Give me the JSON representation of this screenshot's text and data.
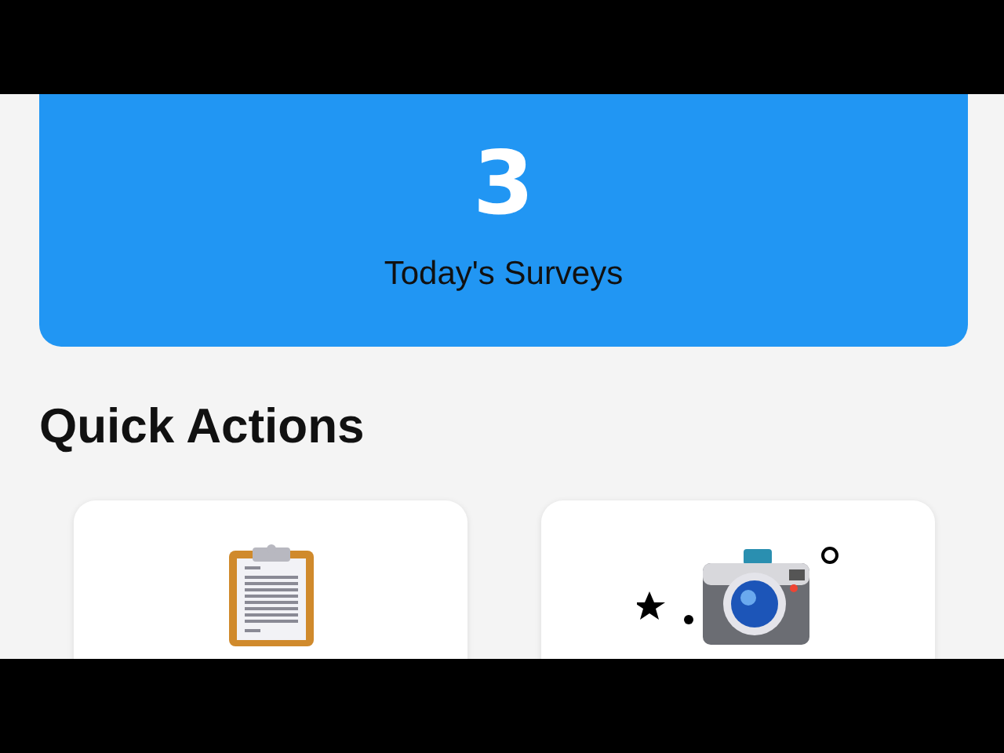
{
  "stat_card": {
    "value": "3",
    "label": "Today's Surveys"
  },
  "section": {
    "title": "Quick Actions"
  },
  "actions": [
    {
      "kind": "clipboard"
    },
    {
      "kind": "camera"
    }
  ]
}
